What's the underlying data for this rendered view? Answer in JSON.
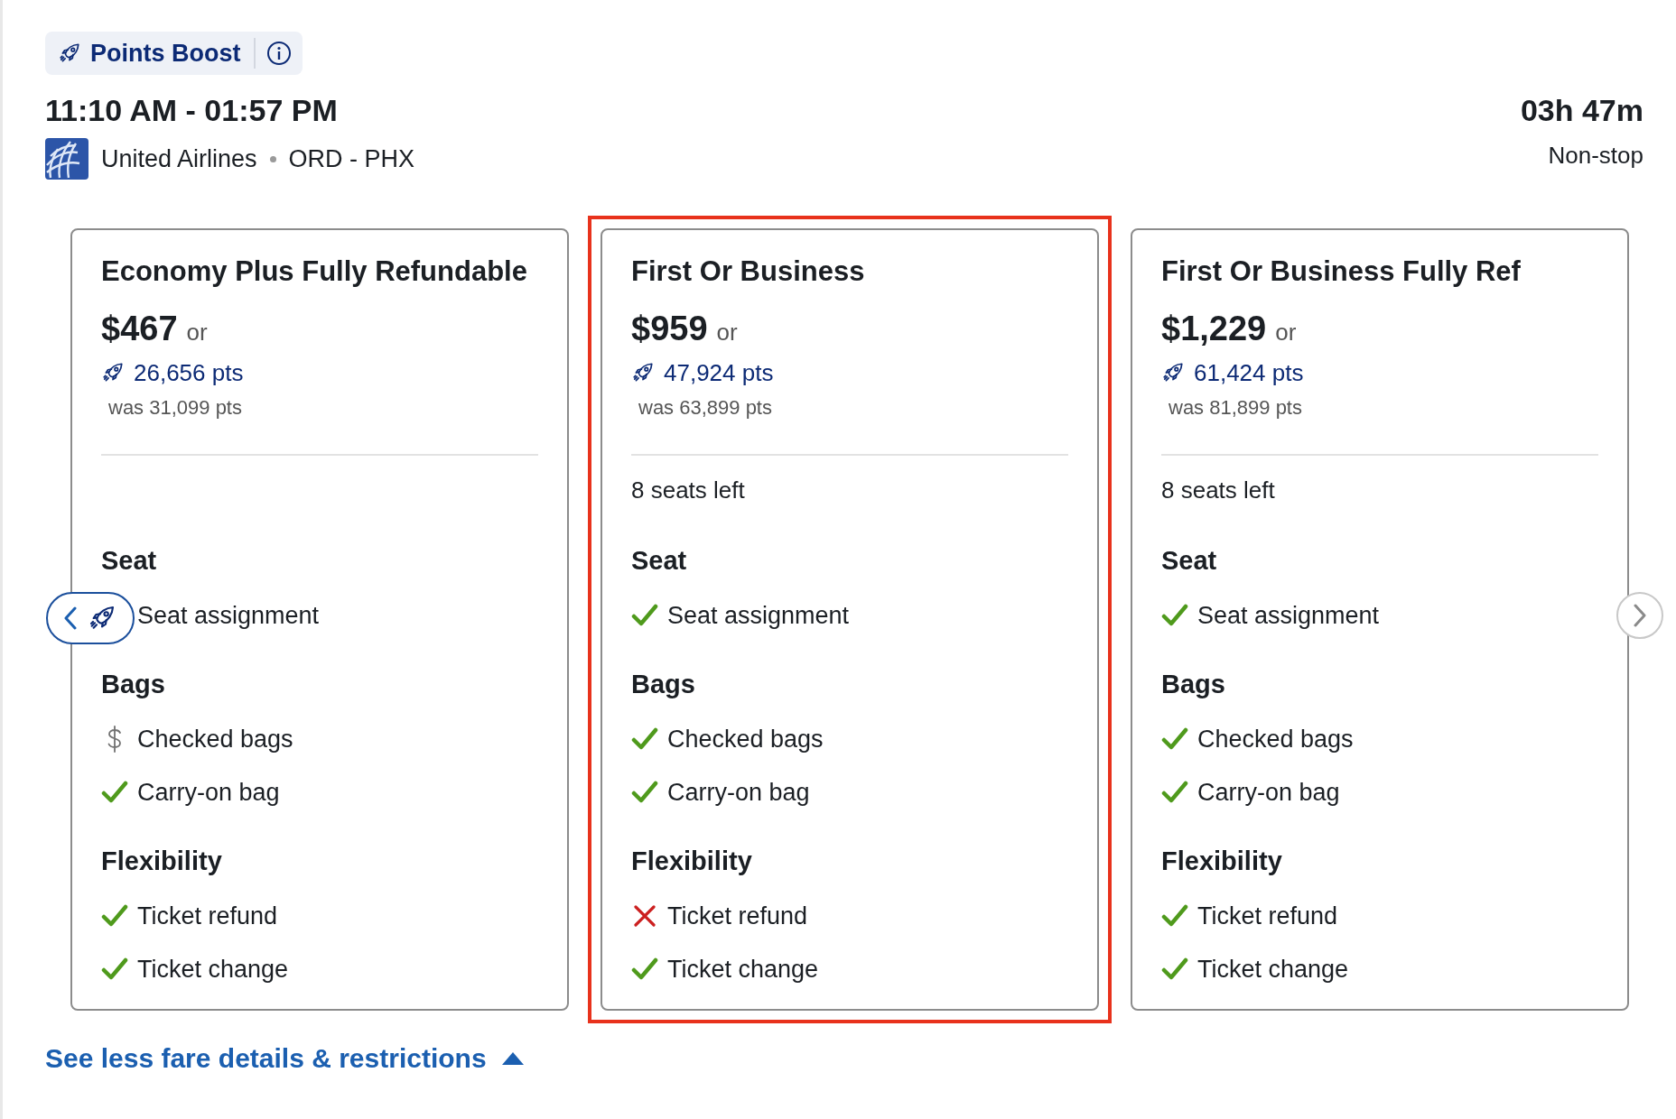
{
  "badge": {
    "label": "Points Boost"
  },
  "flight": {
    "times": "11:10 AM - 01:57 PM",
    "airline": "United Airlines",
    "route": "ORD - PHX",
    "duration": "03h 47m",
    "stops": "Non-stop"
  },
  "fares": [
    {
      "name": "Economy Plus Fully Refundable",
      "price": "$467",
      "or": "or",
      "points": "26,656 pts",
      "was": "was 31,099 pts",
      "selected": false,
      "sections": [
        {
          "title": "Seat",
          "features": [
            {
              "label": "Seat assignment"
            }
          ]
        },
        {
          "title": "Bags",
          "features": [
            {
              "label": "Checked bags",
              "kind": "fee"
            },
            {
              "label": "Carry-on bag",
              "kind": "check"
            }
          ]
        },
        {
          "title": "Flexibility",
          "features": [
            {
              "label": "Ticket refund",
              "kind": "check"
            },
            {
              "label": "Ticket change",
              "kind": "check"
            }
          ]
        }
      ]
    },
    {
      "name": "First Or Business",
      "price": "$959",
      "or": "or",
      "points": "47,924 pts",
      "was": "was 63,899 pts",
      "seats": "8 seats left",
      "selected": true,
      "sections": [
        {
          "title": "Seat",
          "features": [
            {
              "label": "Seat assignment",
              "kind": "check"
            }
          ]
        },
        {
          "title": "Bags",
          "features": [
            {
              "label": "Checked bags",
              "kind": "check"
            },
            {
              "label": "Carry-on bag",
              "kind": "check"
            }
          ]
        },
        {
          "title": "Flexibility",
          "features": [
            {
              "label": "Ticket refund",
              "kind": "cross"
            },
            {
              "label": "Ticket change",
              "kind": "check"
            }
          ]
        }
      ]
    },
    {
      "name": "First Or Business Fully Ref",
      "price": "$1,229",
      "or": "or",
      "points": "61,424 pts",
      "was": "was 81,899 pts",
      "seats": "8 seats left",
      "selected": false,
      "sections": [
        {
          "title": "Seat",
          "features": [
            {
              "label": "Seat assignment",
              "kind": "check"
            }
          ]
        },
        {
          "title": "Bags",
          "features": [
            {
              "label": "Checked bags",
              "kind": "check"
            },
            {
              "label": "Carry-on bag",
              "kind": "check"
            }
          ]
        },
        {
          "title": "Flexibility",
          "features": [
            {
              "label": "Ticket refund",
              "kind": "check"
            },
            {
              "label": "Ticket change",
              "kind": "check"
            }
          ]
        }
      ]
    }
  ],
  "details_link": {
    "label": "See less fare details & restrictions",
    "expanded": true
  }
}
